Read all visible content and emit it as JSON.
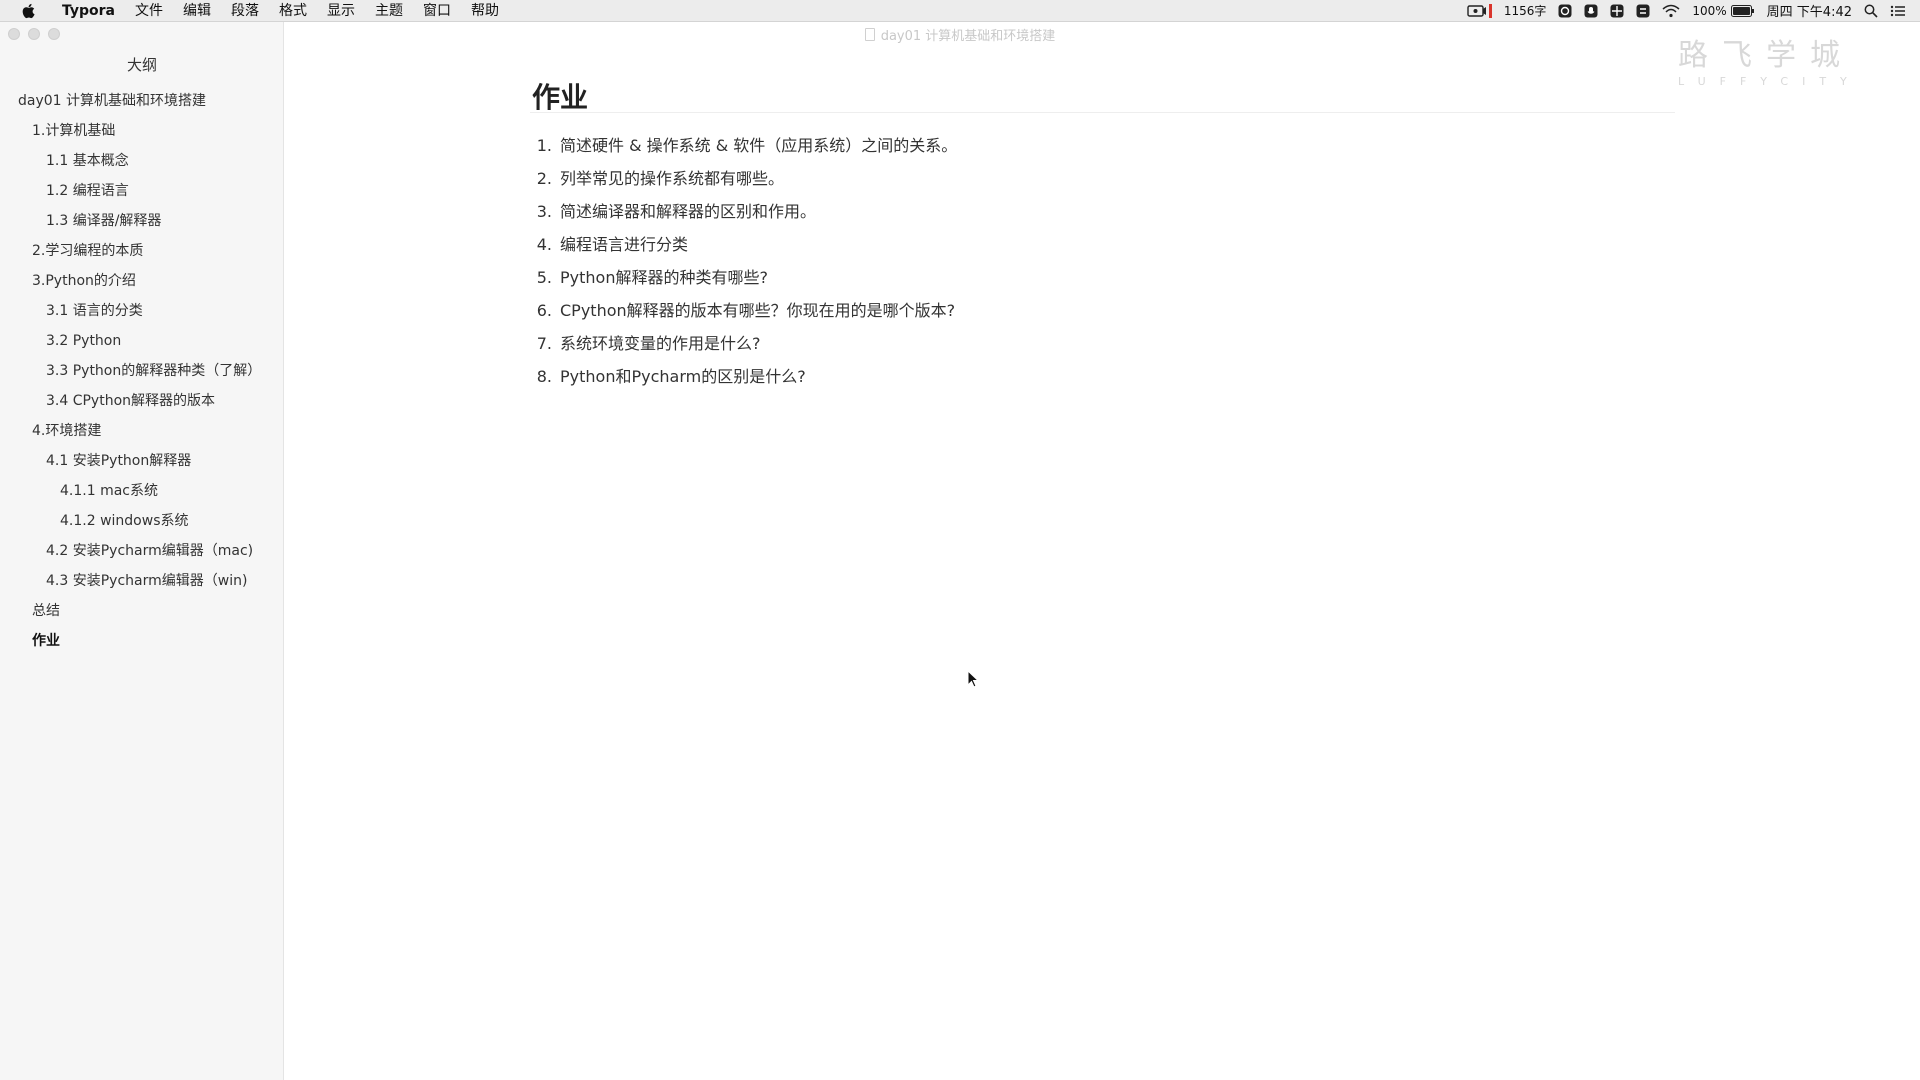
{
  "menubar": {
    "app_name": "Typora",
    "items": [
      "文件",
      "编辑",
      "段落",
      "格式",
      "显示",
      "主题",
      "窗口",
      "帮助"
    ],
    "word_count": "1156字",
    "battery": "100%",
    "clock": "周四 下午4:42"
  },
  "window": {
    "title": "day01 计算机基础和环境搭建"
  },
  "sidebar": {
    "title": "大纲",
    "items": [
      {
        "label": "day01 计算机基础和环境搭建"
      },
      {
        "label": "1.计算机基础"
      },
      {
        "label": "1.1 基本概念"
      },
      {
        "label": "1.2 编程语言"
      },
      {
        "label": "1.3 编译器/解释器"
      },
      {
        "label": "2.学习编程的本质"
      },
      {
        "label": "3.Python的介绍"
      },
      {
        "label": "3.1 语言的分类"
      },
      {
        "label": "3.2 Python"
      },
      {
        "label": "3.3 Python的解释器种类（了解）"
      },
      {
        "label": "3.4 CPython解释器的版本"
      },
      {
        "label": "4.环境搭建"
      },
      {
        "label": "4.1 安装Python解释器"
      },
      {
        "label": "4.1.1 mac系统"
      },
      {
        "label": "4.1.2 windows系统"
      },
      {
        "label": "4.2 安装Pycharm编辑器（mac)"
      },
      {
        "label": "4.3 安装Pycharm编辑器（win)"
      },
      {
        "label": "总结"
      },
      {
        "label": "作业"
      }
    ]
  },
  "document": {
    "heading": "作业",
    "items": [
      {
        "num": "1.",
        "text": "简述硬件 & 操作系统 & 软件（应用系统）之间的关系。"
      },
      {
        "num": "2.",
        "text": "列举常见的操作系统都有哪些。"
      },
      {
        "num": "3.",
        "text": "简述编译器和解释器的区别和作用。"
      },
      {
        "num": "4.",
        "text": "编程语言进行分类"
      },
      {
        "num": "5.",
        "text": "Python解释器的种类有哪些?"
      },
      {
        "num": "6.",
        "text": "CPython解释器的版本有哪些？你现在用的是哪个版本?"
      },
      {
        "num": "7.",
        "text": "系统环境变量的作用是什么?"
      },
      {
        "num": "8.",
        "text": "Python和Pycharm的区别是什么?"
      }
    ]
  },
  "watermark": {
    "cn": "路飞学城",
    "en": "LUFFYCITY"
  },
  "icons": [
    "apple-icon",
    "screen-record-icon",
    "wifi-icon",
    "battery-icon",
    "search-icon",
    "list-icon"
  ]
}
